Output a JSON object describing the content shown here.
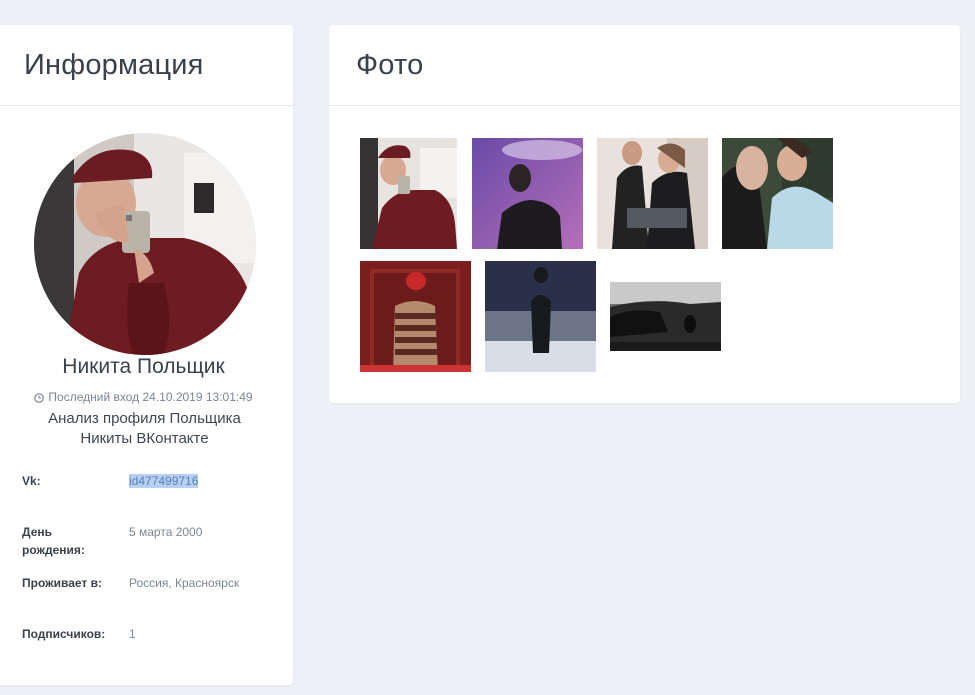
{
  "info": {
    "title": "Информация",
    "name": "Никита Польщик",
    "last_seen": "Последний вход 24.10.2019 13:01:49",
    "description": "Анализ профиля Польщика Никиты ВКонтакте",
    "fields": [
      {
        "label": "Vk:",
        "value": "id477499716"
      },
      {
        "label": "День рождения:",
        "value": "5 марта 2000"
      },
      {
        "label": "Проживает в:",
        "value": "Россия, Красноярск"
      },
      {
        "label": "Подписчиков:",
        "value": "1"
      }
    ]
  },
  "photos": {
    "title": "Фото",
    "count": 7
  },
  "colors": {
    "background": "#edf0f5",
    "card": "#ffffff",
    "selection": "#b5d0f2"
  }
}
